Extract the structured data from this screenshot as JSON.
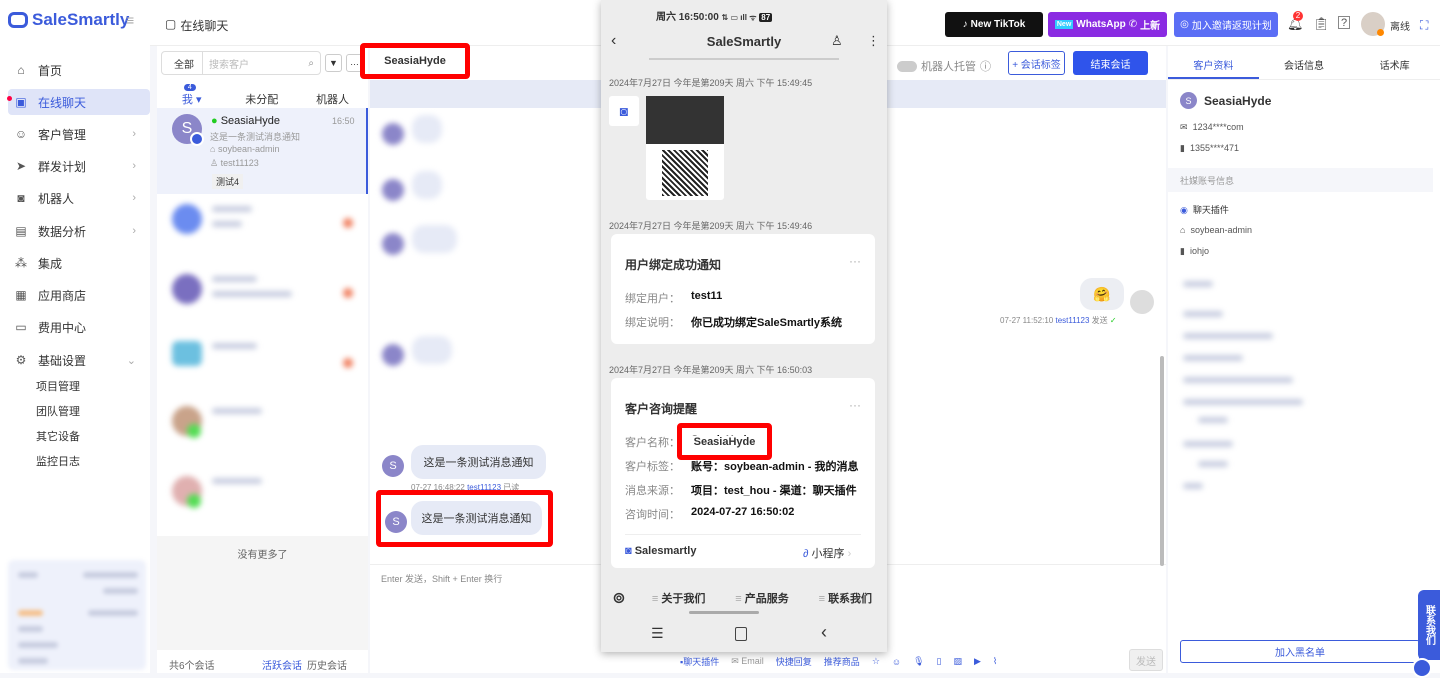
{
  "app": {
    "logo": "SaleSmartly",
    "page_title": "在线聊天"
  },
  "sidebar": {
    "items": [
      {
        "label": "首页",
        "icon": "home-icon"
      },
      {
        "label": "在线聊天",
        "icon": "chat-icon"
      },
      {
        "label": "客户管理",
        "icon": "users-icon"
      },
      {
        "label": "群发计划",
        "icon": "send-icon"
      },
      {
        "label": "机器人",
        "icon": "robot-icon"
      },
      {
        "label": "数据分析",
        "icon": "chart-icon"
      },
      {
        "label": "集成",
        "icon": "integration-icon"
      },
      {
        "label": "应用商店",
        "icon": "apps-icon"
      },
      {
        "label": "费用中心",
        "icon": "wallet-icon"
      },
      {
        "label": "基础设置",
        "icon": "gear-icon"
      }
    ],
    "sub_items": [
      "项目管理",
      "团队管理",
      "其它设备",
      "监控日志"
    ]
  },
  "topbar": {
    "banners": [
      "New TikTok",
      "WhatsApp",
      "上新",
      "加入邀请返现计划"
    ],
    "new_badge": "New",
    "notification_count": "2",
    "status": "离线"
  },
  "conversations": {
    "filter": "全部",
    "search_placeholder": "搜索客户",
    "tabs": [
      "我",
      "未分配",
      "机器人"
    ],
    "my_count": "4",
    "active": {
      "name": "SeasiaHyde",
      "time": "16:50",
      "preview": "这是一条测试消息通知",
      "account": "soybean-admin",
      "user": "test11123",
      "tag": "测试4"
    },
    "no_more": "没有更多了",
    "total": "共6个会话",
    "active_link": "活跃会话",
    "history_link": "历史会话"
  },
  "chat": {
    "customer_name": "SeasiaHyde",
    "robot_toggle": "机器人托管",
    "add_tag": "+ 会话标签",
    "end": "结束会话",
    "sent": {
      "time": "07-27 11:52:10",
      "user": "test11123",
      "status": "发送"
    },
    "messages": [
      {
        "text": "这是一条测试消息通知",
        "time": "07-27 16:48:22",
        "user": "test11123",
        "status": "已读"
      },
      {
        "text": "这是一条测试消息通知"
      }
    ],
    "avatar_letter": "S",
    "input_hint": "Enter 发送，Shift + Enter 换行",
    "toolbar": {
      "channel": "聊天插件",
      "email": "Email",
      "quick_reply": "快捷回复",
      "recommend": "推荐商品",
      "send": "发送"
    }
  },
  "right": {
    "tabs": [
      "客户资料",
      "会话信息",
      "话术库"
    ],
    "name": "SeasiaHyde",
    "email": "1234****com",
    "phone": "1355****471",
    "social_header": "社媒账号信息",
    "channel": "聊天插件",
    "account": "soybean-admin",
    "tag": "iohjo",
    "blacklist": "加入黑名单"
  },
  "phone": {
    "status_time": "周六 16:50:00",
    "battery": "87",
    "title": "SaleSmartly",
    "ts1": "2024年7月27日 今年是第209天 周六 下午 15:49:45",
    "ts2": "2024年7月27日 今年是第209天 周六 下午 15:49:46",
    "card1": {
      "title": "用户绑定成功通知",
      "rows": [
        {
          "k": "绑定用户：",
          "v": "test11"
        },
        {
          "k": "绑定说明：",
          "v": "你已成功绑定SaleSmartly系统"
        }
      ]
    },
    "ts3": "2024年7月27日 今年是第209天 周六 下午 16:50:03",
    "card2": {
      "title": "客户咨询提醒",
      "rows": [
        {
          "k": "客户名称：",
          "v": "SeasiaHyde"
        },
        {
          "k": "客户标签：",
          "v": "账号：soybean-admin - 我的消息"
        },
        {
          "k": "消息来源：",
          "v": "项目：test_hou - 渠道：聊天插件"
        },
        {
          "k": "咨询时间：",
          "v": "2024-07-27 16:50:02"
        }
      ],
      "footer": "Salesmartly",
      "mini": "小程序"
    },
    "menu": [
      "关于我们",
      "产品服务",
      "联系我们"
    ]
  },
  "contact_us": "联系我们"
}
